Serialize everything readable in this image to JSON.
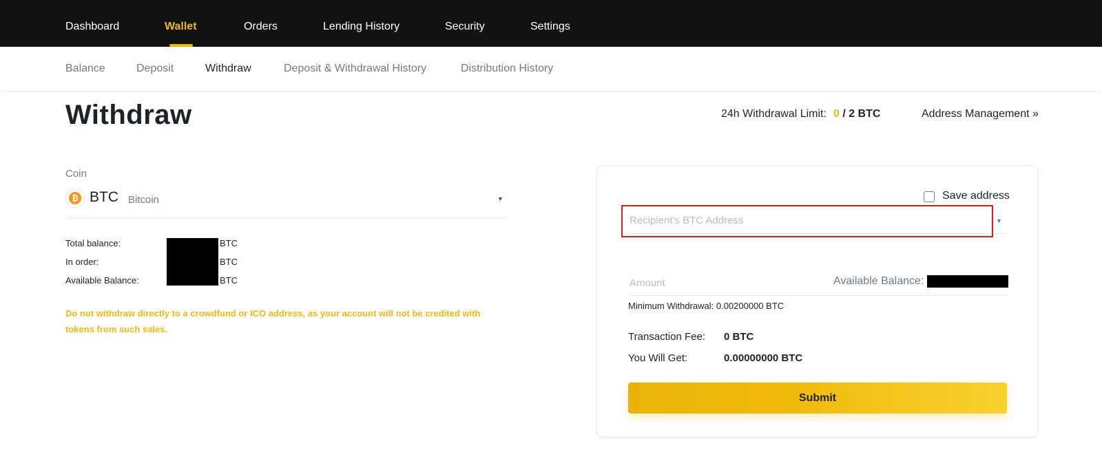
{
  "topnav": {
    "items": [
      "Dashboard",
      "Wallet",
      "Orders",
      "Lending History",
      "Security",
      "Settings"
    ],
    "active": "Wallet"
  },
  "subnav": {
    "items": [
      "Balance",
      "Deposit",
      "Withdraw",
      "Deposit & Withdrawal History",
      "Distribution History"
    ],
    "active": "Withdraw"
  },
  "page": {
    "title": "Withdraw",
    "limit_label": "24h Withdrawal Limit:",
    "limit_used": "0",
    "limit_total": "/ 2 BTC",
    "address_management": "Address Management »"
  },
  "coin": {
    "label": "Coin",
    "symbol": "BTC",
    "name": "Bitcoin",
    "icon": "bitcoin-icon",
    "icon_glyph": "₿",
    "icon_color": "#f7931a"
  },
  "balances": [
    {
      "label": "Total balance:",
      "unit": "BTC"
    },
    {
      "label": "In order:",
      "unit": "BTC"
    },
    {
      "label": "Available Balance:",
      "unit": "BTC"
    }
  ],
  "warning": "Do not withdraw directly to a crowdfund or ICO address, as your account will not be credited with tokens from such sales.",
  "form": {
    "save_address": "Save address",
    "address_placeholder": "Recipient's BTC Address",
    "address_value": "",
    "amount_placeholder": "Amount",
    "amount_value": "",
    "available_balance_label": "Available Balance:",
    "min_withdrawal": "Minimum Withdrawal: 0.00200000 BTC",
    "fee_label": "Transaction Fee:",
    "fee_value": "0 BTC",
    "get_label": "You Will Get:",
    "get_value": "0.00000000 BTC",
    "submit": "Submit"
  },
  "colors": {
    "accent": "#f0b90b",
    "nav_bg": "#121212",
    "highlight_border": "#e0191b"
  }
}
